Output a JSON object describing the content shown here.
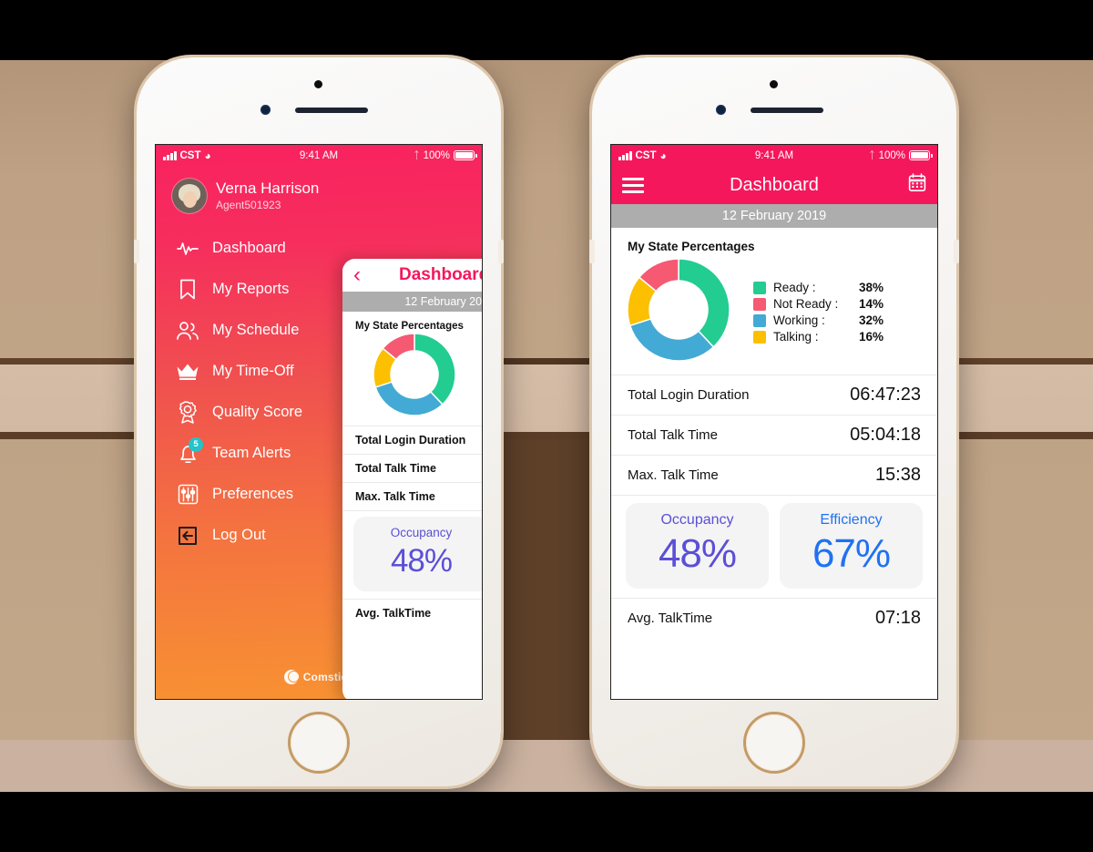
{
  "scene": {
    "background_wall_color": "#bfa386",
    "background_dark_panel_color": "#5e4029",
    "phone_body_color": "#f7f5f2"
  },
  "status_bar": {
    "carrier": "CST",
    "time": "9:41 AM",
    "battery_pct": "100%",
    "signal_icon": "signal-bars-icon",
    "wifi_icon": "wifi-icon",
    "bluetooth_icon": "bluetooth-icon",
    "battery_icon": "battery-icon"
  },
  "drawer": {
    "user_name": "Verna Harrison",
    "user_id": "Agent501923",
    "avatar_icon": "avatar",
    "items": [
      {
        "label": "Dashboard",
        "icon": "pulse-icon"
      },
      {
        "label": "My Reports",
        "icon": "bookmark-icon"
      },
      {
        "label": "My Schedule",
        "icon": "people-icon"
      },
      {
        "label": "My Time-Off",
        "icon": "crown-icon"
      },
      {
        "label": "Quality Score",
        "icon": "award-icon"
      },
      {
        "label": "Team Alerts",
        "icon": "bell-icon",
        "badge": "5"
      },
      {
        "label": "Preferences",
        "icon": "sliders-icon"
      },
      {
        "label": "Log Out",
        "icon": "logout-icon"
      }
    ],
    "brand": "Comstice",
    "brand_logo_icon": "comstice-logo-icon"
  },
  "dashboard": {
    "nav_title": "Dashboard",
    "menu_icon": "hamburger-icon",
    "calendar_icon": "calendar-icon",
    "back_icon": "chevron-left-icon",
    "date": "12 February 2019",
    "section_title": "My State Percentages",
    "stats": [
      {
        "label": "Total Login Duration",
        "value": "06:47:23"
      },
      {
        "label": "Total Talk Time",
        "value": "05:04:18"
      },
      {
        "label": "Max. Talk Time",
        "value": "15:38"
      }
    ],
    "cards": [
      {
        "label": "Occupancy",
        "value": "48%",
        "color": "#5b4fd6"
      },
      {
        "label": "Efficiency",
        "value": "67%",
        "color": "#1f72f2"
      }
    ],
    "footer_stat": {
      "label": "Avg. TalkTime",
      "value": "07:18"
    }
  },
  "chart_data": {
    "type": "pie",
    "title": "My State Percentages",
    "categories": [
      "Ready",
      "Not Ready",
      "Working",
      "Talking"
    ],
    "values": [
      38,
      14,
      32,
      16
    ],
    "value_labels": [
      "38%",
      "14%",
      "32%",
      "16%"
    ],
    "colors": [
      "#23cc91",
      "#f55a72",
      "#42aad4",
      "#fcc000"
    ],
    "legend_labels": [
      "Ready :",
      "Not Ready :",
      "Working :",
      "Talking :"
    ],
    "legend_position": "right",
    "donut": true,
    "inner_radius_ratio": 0.6,
    "start_angle_deg": 0,
    "direction": "clockwise",
    "units": "percent"
  }
}
